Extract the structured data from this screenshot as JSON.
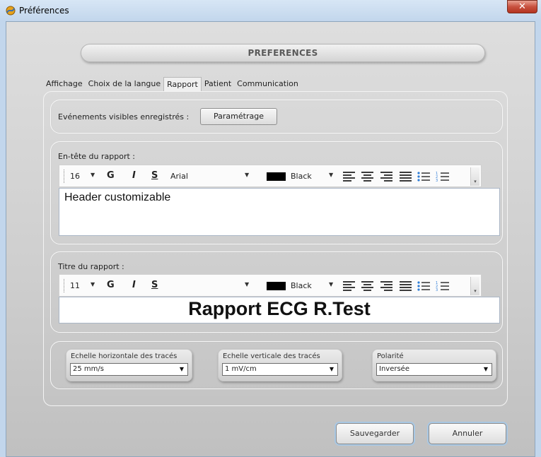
{
  "window": {
    "title": "Préférences"
  },
  "banner": {
    "title": "PREFERENCES"
  },
  "tabs": [
    {
      "label": "Affichage"
    },
    {
      "label": "Choix de la langue"
    },
    {
      "label": "Rapport",
      "active": true
    },
    {
      "label": "Patient"
    },
    {
      "label": "Communication"
    }
  ],
  "events": {
    "label": "Evénements visibles enregistrés :",
    "button_label": "Paramétrage"
  },
  "header": {
    "label": "En-tête du rapport :",
    "toolbar": {
      "font_size": "16",
      "bold": "G",
      "italic": "I",
      "underline": "S",
      "font_family": "Arial",
      "color_name": "Black",
      "color": "#000000"
    },
    "content": "Header customizable"
  },
  "report_title": {
    "label": "Titre du rapport :",
    "toolbar": {
      "font_size": "11",
      "bold": "G",
      "italic": "I",
      "underline": "S",
      "font_family": "",
      "color_name": "Black",
      "color": "#000000"
    },
    "content": "Rapport ECG R.Test"
  },
  "settings": {
    "horizontal_scale": {
      "label": "Echelle horizontale des tracés",
      "value": "25 mm/s"
    },
    "vertical_scale": {
      "label": "Echelle verticale des tracés",
      "value": "1 mV/cm"
    },
    "polarity": {
      "label": "Polarité",
      "value": "Inversée"
    }
  },
  "footer": {
    "save_label": "Sauvegarder",
    "cancel_label": "Annuler"
  }
}
